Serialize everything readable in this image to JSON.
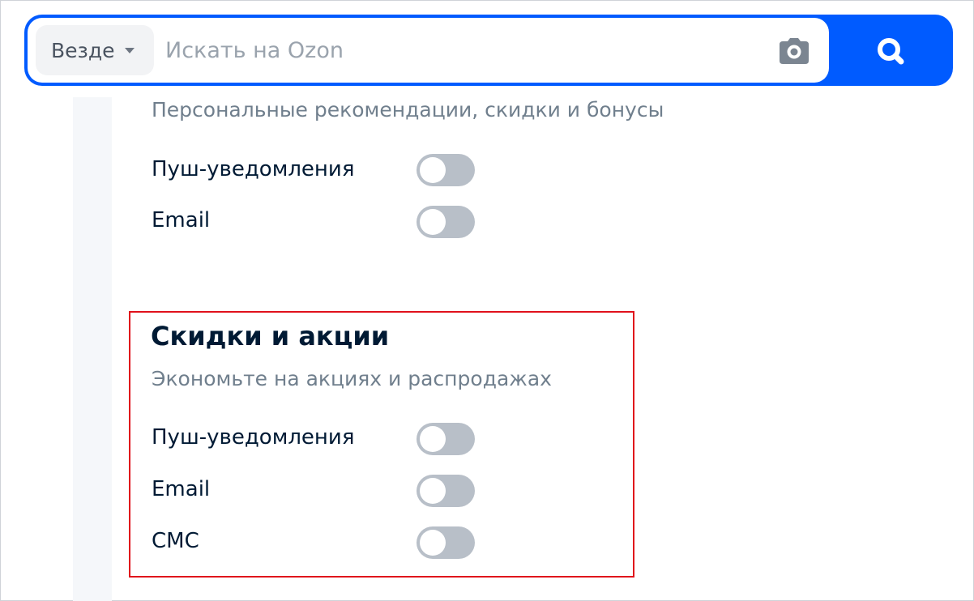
{
  "search": {
    "scope_label": "Везде",
    "placeholder": "Искать на Ozon",
    "icons": [
      "chevron-down-icon",
      "camera-icon",
      "search-icon"
    ]
  },
  "personal_section": {
    "subtitle": "Персональные рекомендации, скидки и бонусы",
    "options": [
      {
        "label": "Пуш-уведомления",
        "enabled": false
      },
      {
        "label": "Email",
        "enabled": false
      }
    ]
  },
  "discounts_section": {
    "title": "Скидки и акции",
    "subtitle": "Экономьте на акциях и распродажах",
    "options": [
      {
        "label": "Пуш-уведомления",
        "enabled": false
      },
      {
        "label": "Email",
        "enabled": false
      },
      {
        "label": "СМС",
        "enabled": false
      }
    ]
  },
  "colors": {
    "brand": "#005bff",
    "toggle_off": "#b8bfc8",
    "highlight": "#e0111b",
    "text_primary": "#001a34",
    "text_secondary": "#707f8d"
  }
}
